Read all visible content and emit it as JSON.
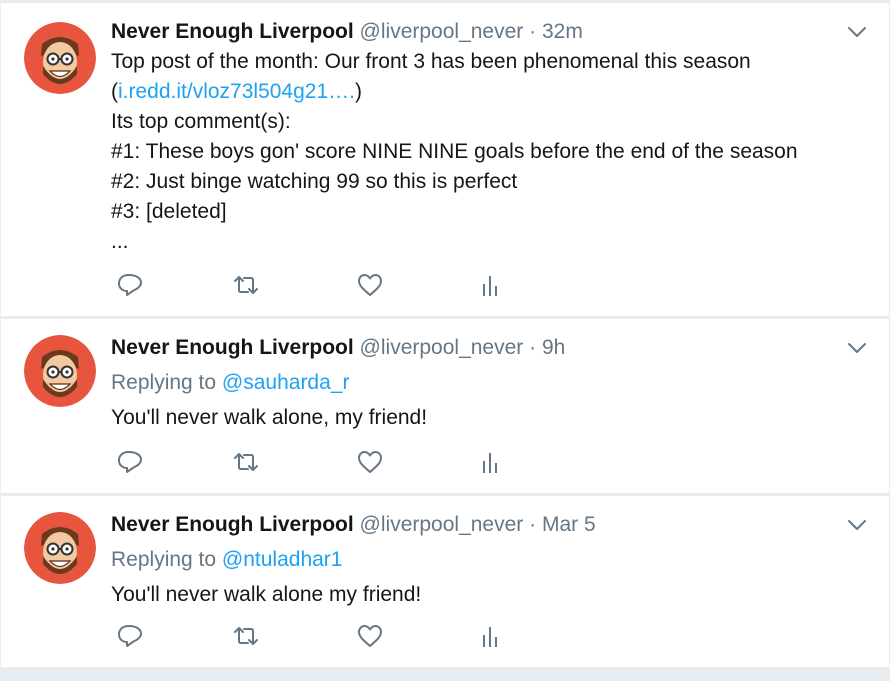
{
  "tweets": [
    {
      "author_name": "Never Enough Liverpool",
      "handle": "@liverpool_never",
      "separator": "·",
      "time": "32m",
      "lines": [
        "Top post of the month: Our front 3 has been phenomenal this season",
        "Its top comment(s):",
        "#1: These boys gon' score NINE NINE goals before the end of the season",
        "#2: Just binge watching 99 so this is perfect",
        "#3: [deleted]",
        "..."
      ],
      "link_open": "(",
      "link_text": "i.redd.it/vloz73l504g21….",
      "link_close": ")"
    },
    {
      "author_name": "Never Enough Liverpool",
      "handle": "@liverpool_never",
      "separator": "·",
      "time": "9h",
      "replying_prefix": "Replying to",
      "replying_to": "@sauharda_r",
      "text": "You'll never walk alone, my friend!"
    },
    {
      "author_name": "Never Enough Liverpool",
      "handle": "@liverpool_never",
      "separator": "·",
      "time": "Mar 5",
      "replying_prefix": "Replying to",
      "replying_to": "@ntuladhar1",
      "text": "You'll never walk alone my friend!"
    }
  ],
  "icons": {
    "reply": "reply-icon",
    "retweet": "retweet-icon",
    "like": "heart-icon",
    "stats": "analytics-icon",
    "menu": "chevron-down-icon"
  },
  "colors": {
    "link": "#1da1f2",
    "secondary_text": "#657786",
    "icon": "#657786",
    "avatar_bg": "#e8553f",
    "background": "#e6ecf0"
  }
}
